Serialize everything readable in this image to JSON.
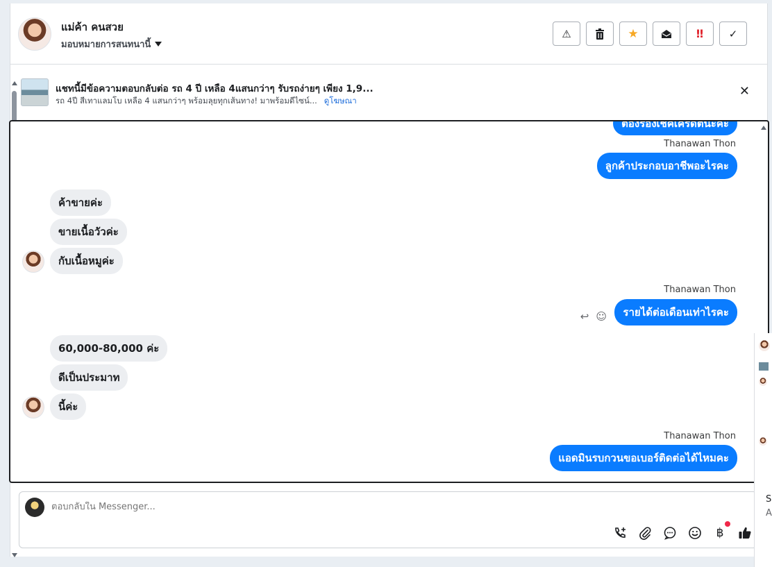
{
  "header": {
    "contact_name": "แม่ค้า คนสวย",
    "assign_label": "มอบหมายการสนทนานี้",
    "actions": [
      {
        "name": "report-button",
        "glyph": "⚠"
      },
      {
        "name": "delete-button",
        "glyph": "🗑"
      },
      {
        "name": "star-button",
        "glyph": "★"
      },
      {
        "name": "mark-unread-button",
        "glyph": "✉"
      },
      {
        "name": "priority-button",
        "glyph": "‼"
      },
      {
        "name": "done-button",
        "glyph": "✓"
      }
    ]
  },
  "ad": {
    "title": "แชทนี้มีข้อความตอบกลับต่อ รถ 4 ปี เหลือ 4แสนกว่าๆ รับรถง่ายๆ เพียง 1,9...",
    "subtitle": "รถ 4ปี สีเทาแลมโบ เหลือ 4 แสนกว่าๆ พร้อมลุยทุกเส้นทาง! มาพร้อมดีไซน์...",
    "link": "ดูโฆษณา"
  },
  "messages": {
    "out_0": "ต้องรองเช็คเครดิตนะคะ",
    "sender_1": "Thanawan Thon",
    "out_1": "ลูกค้าประกอบอาชีพอะไรคะ",
    "in_1": "ค้าขายค่ะ",
    "in_2": "ขายเนื้อวัวค่ะ",
    "in_3": "กับเนื้อหมูค่ะ",
    "sender_2": "Thanawan Thon",
    "out_2": "รายได้ต่อเดือนเท่าไรคะ",
    "in_4": "60,000-80,000 ค่ะ",
    "in_5": "ดีเป็นประมาท",
    "in_6": "นี้ค่ะ",
    "sender_3": "Thanawan Thon",
    "out_3": "แอดมินรบกวนขอเบอร์ติดต่อได้ไหมคะ"
  },
  "composer": {
    "placeholder": "ตอบกลับใน Messenger..."
  },
  "side": {
    "text_1": "So",
    "text_2": "A"
  },
  "colors": {
    "accent": "#0a7cff",
    "incoming_bubble": "#eceef1",
    "link": "#216fdb",
    "notification": "#f02849"
  }
}
